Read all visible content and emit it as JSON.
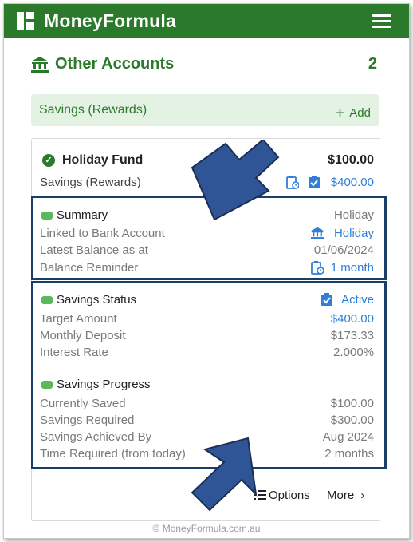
{
  "app": {
    "title": "MoneyFormula",
    "footer": "© MoneyFormula.com.au"
  },
  "section": {
    "title": "Other Accounts",
    "count": "2"
  },
  "category": {
    "label": "Savings (Rewards)",
    "add_label": "Add"
  },
  "account": {
    "name": "Holiday Fund",
    "amount": "$100.00",
    "category": "Savings (Rewards)",
    "target": "$400.00"
  },
  "summary": {
    "title": "Summary",
    "title_value": "Holiday",
    "rows": [
      {
        "label": "Linked to Bank Account",
        "value": "Holiday"
      },
      {
        "label": "Latest Balance as at",
        "value": "01/06/2024"
      },
      {
        "label": "Balance Reminder",
        "value": "1 month"
      }
    ]
  },
  "savings_status": {
    "title": "Savings Status",
    "status": "Active",
    "rows": [
      {
        "label": "Target Amount",
        "value": "$400.00"
      },
      {
        "label": "Monthly Deposit",
        "value": "$173.33"
      },
      {
        "label": "Interest Rate",
        "value": "2.000%"
      }
    ]
  },
  "savings_progress": {
    "title": "Savings Progress",
    "rows": [
      {
        "label": "Currently Saved",
        "value": "$100.00"
      },
      {
        "label": "Savings Required",
        "value": "$300.00"
      },
      {
        "label": "Savings Achieved By",
        "value": "Aug 2024"
      },
      {
        "label": "Time Required (from today)",
        "value": "2 months"
      }
    ]
  },
  "actions": {
    "options_label": "Options",
    "more_label": "More"
  },
  "colors": {
    "brand": "#2b7a2b",
    "link": "#2f7fd8",
    "highlight": "#1a3e66",
    "arrow": "#2f5597"
  }
}
